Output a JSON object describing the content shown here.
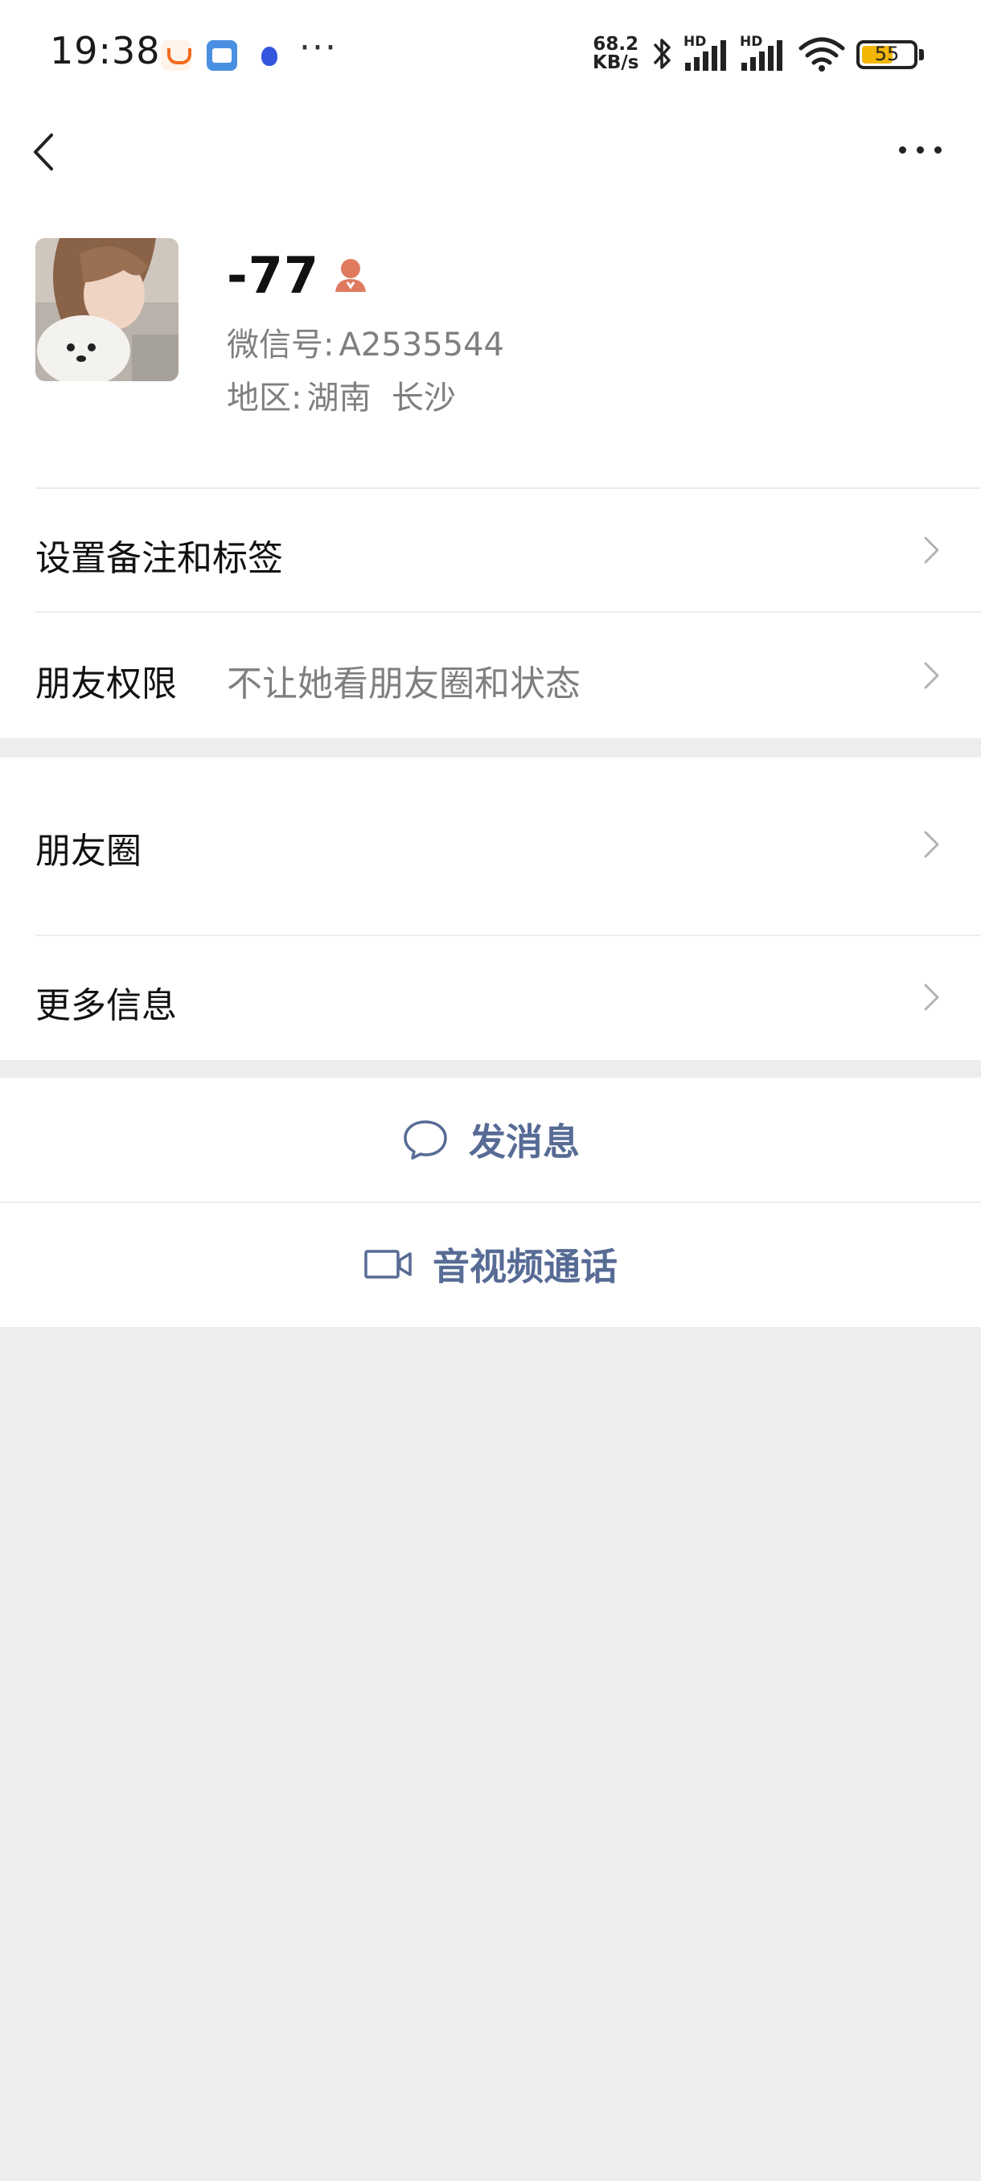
{
  "status_bar": {
    "time": "19:38",
    "dots": "···",
    "net_speed_value": "68.2",
    "net_speed_unit": "KB/s",
    "signal1_label": "HD",
    "signal2_label": "HD",
    "battery_level": "55",
    "apps": [
      "didi-app-icon",
      "wallet-app-icon",
      "baidu-app-icon"
    ]
  },
  "nav": {
    "back_icon": "chevron-left-icon",
    "more_icon": "more-dots-icon"
  },
  "profile": {
    "name": "-77",
    "gender_icon": "female-icon",
    "wechat_id_label": "微信号:",
    "wechat_id": "A2535544",
    "region_label": "地区:",
    "region": "湖南  长沙"
  },
  "menu": {
    "remark_tags": "设置备注和标签",
    "friend_permission": "朋友权限",
    "friend_permission_value": "不让她看朋友圈和状态",
    "moments": "朋友圈",
    "more_info": "更多信息"
  },
  "actions": {
    "send_message": "发消息",
    "av_call": "音视频通话"
  },
  "colors": {
    "link_blue": "#576b95",
    "gender_female": "#e07a5f",
    "page_bg": "#ededed"
  }
}
